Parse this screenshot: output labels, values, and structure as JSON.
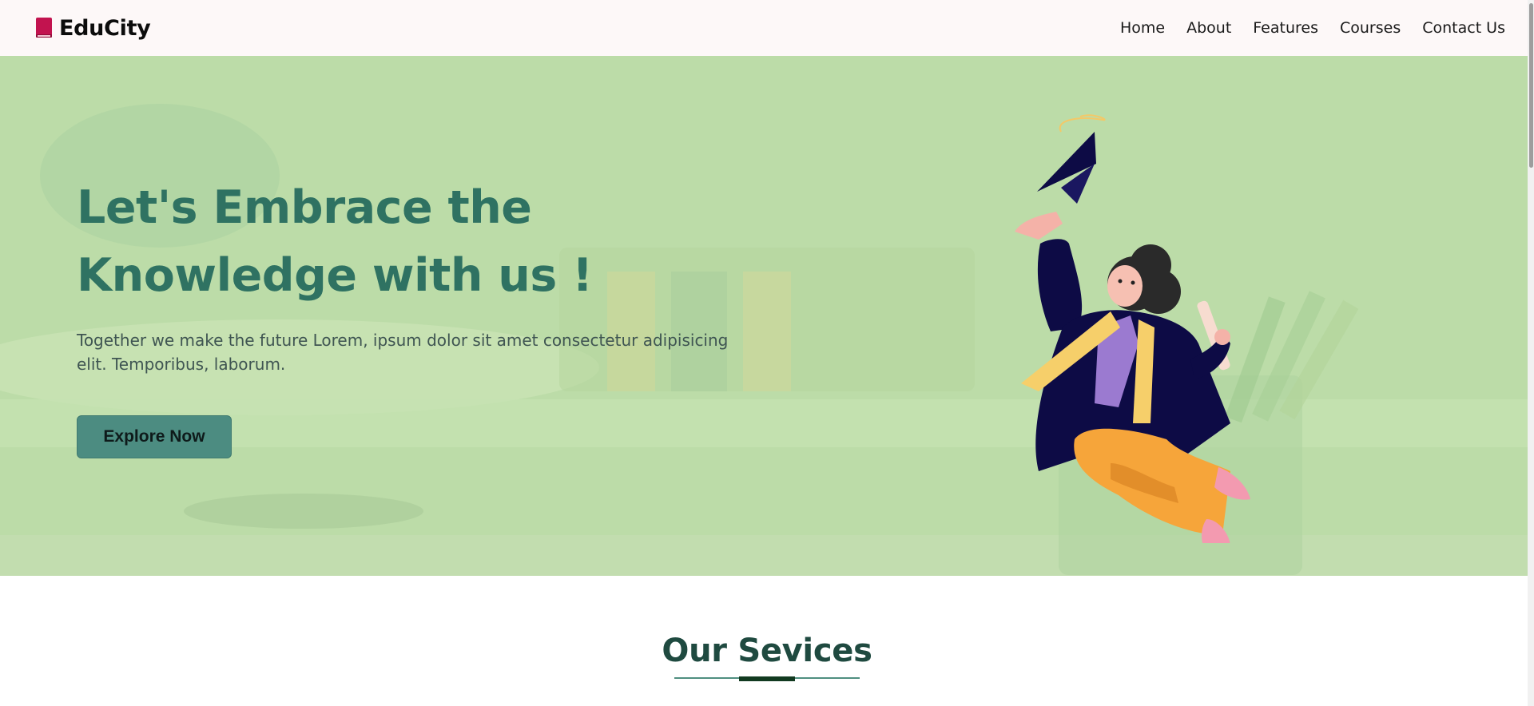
{
  "brand": {
    "name": "EduCity",
    "icon": "book-icon"
  },
  "nav": {
    "items": [
      {
        "label": "Home"
      },
      {
        "label": "About"
      },
      {
        "label": "Features"
      },
      {
        "label": "Courses"
      },
      {
        "label": "Contact Us"
      }
    ]
  },
  "hero": {
    "title_line1": "Let's Embrace the",
    "title_line2": "Knowledge with us !",
    "text": "Together we make the future Lorem, ipsum dolor sit amet consectetur adipisicing elit. Temporibus, laborum.",
    "button_label": "Explore Now",
    "illustration": "graduate-girl-icon"
  },
  "services": {
    "title": "Our Sevices"
  },
  "colors": {
    "hero_bg": "#bcdca8",
    "title": "#2f7262",
    "button": "#4c8c81",
    "nav_bg": "#fdf8f8",
    "services_title": "#1f4a40"
  }
}
